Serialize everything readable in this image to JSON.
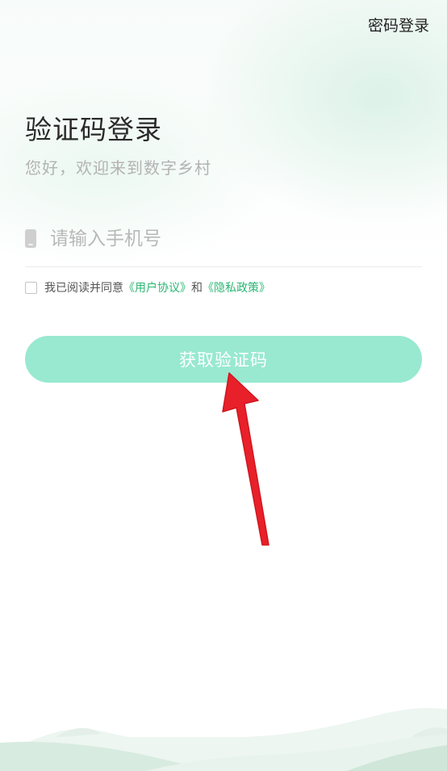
{
  "header": {
    "password_login": "密码登录"
  },
  "main": {
    "title": "验证码登录",
    "subtitle": "您好，欢迎来到数字乡村",
    "phone_placeholder": "请输入手机号",
    "agreement": {
      "prefix": "我已阅读并同意",
      "user_agreement": "《用户协议》",
      "conjunction": "和",
      "privacy_policy": "《隐私政策》",
      "checked": false
    },
    "get_code_button": "获取验证码"
  },
  "icons": {
    "phone": "phone-icon",
    "checkbox": "checkbox-icon"
  },
  "colors": {
    "accent": "#2bb673",
    "button_bg": "#98e9d0",
    "annotation_arrow": "#e8202a"
  }
}
